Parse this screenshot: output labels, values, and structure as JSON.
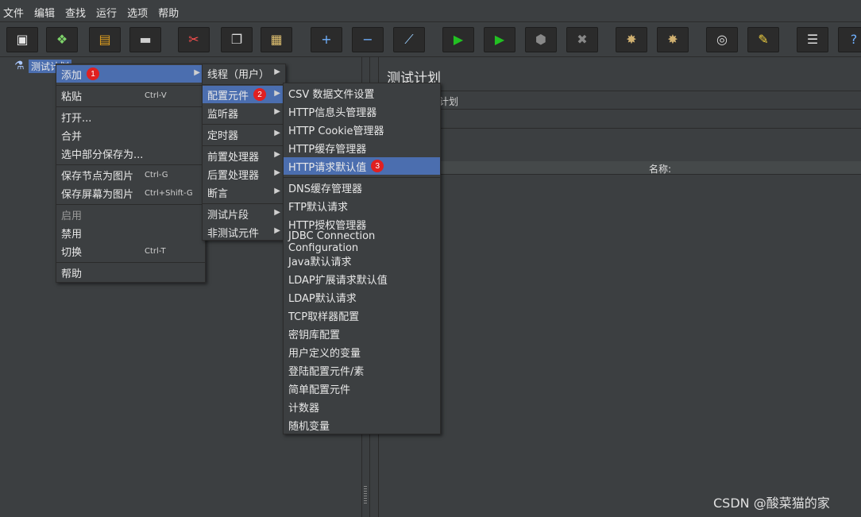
{
  "menubar": [
    "文件",
    "编辑",
    "查找",
    "运行",
    "选项",
    "帮助"
  ],
  "toolbar": [
    {
      "icon": "new-icon",
      "glyph": "▣",
      "color": "#e6e6e6"
    },
    {
      "icon": "templates-icon",
      "glyph": "❖",
      "color": "#7ed36a"
    },
    {
      "icon": "open-icon",
      "glyph": "▤",
      "color": "#e0a020"
    },
    {
      "icon": "save-icon",
      "glyph": "▬",
      "color": "#cfcfcf"
    },
    {
      "icon": "cut-icon",
      "glyph": "✂",
      "color": "#ff5050"
    },
    {
      "icon": "copy-icon",
      "glyph": "❐",
      "color": "#dddddd"
    },
    {
      "icon": "paste-icon",
      "glyph": "▦",
      "color": "#e0c070"
    },
    {
      "icon": "expand-icon",
      "glyph": "+",
      "color": "#6fb0ff"
    },
    {
      "icon": "collapse-icon",
      "glyph": "−",
      "color": "#6fb0ff"
    },
    {
      "icon": "toggle-icon",
      "glyph": "⟋",
      "color": "#9bd0ff"
    },
    {
      "icon": "start-icon",
      "glyph": "▶",
      "color": "#22c022"
    },
    {
      "icon": "start-no-pauses-icon",
      "glyph": "▶",
      "color": "#22c022"
    },
    {
      "icon": "stop-icon",
      "glyph": "⬢",
      "color": "#888888"
    },
    {
      "icon": "shutdown-icon",
      "glyph": "✖",
      "color": "#888888"
    },
    {
      "icon": "clear-icon",
      "glyph": "✸",
      "color": "#d0b070"
    },
    {
      "icon": "clear-all-icon",
      "glyph": "✸",
      "color": "#d0b070"
    },
    {
      "icon": "search-icon",
      "glyph": "◎",
      "color": "#dddddd"
    },
    {
      "icon": "reset-search-icon",
      "glyph": "✎",
      "color": "#f0d040"
    },
    {
      "icon": "function-helper-icon",
      "glyph": "☰",
      "color": "#dddddd"
    },
    {
      "icon": "help-icon",
      "glyph": "?",
      "color": "#6fb0ff"
    }
  ],
  "tree": {
    "label": "测试计划",
    "icon": "test-plan-icon"
  },
  "right": {
    "title": "测试计划",
    "name_value": "计划",
    "name_header": "名称:"
  },
  "menu1": {
    "items": [
      {
        "label": "添加",
        "badge": "1",
        "arrow": true,
        "selected": true
      },
      {
        "label": "粘贴",
        "shortcut": "Ctrl-V"
      },
      {
        "label": "打开..."
      },
      {
        "label": "合并"
      },
      {
        "label": "选中部分保存为..."
      },
      {
        "label": "保存节点为图片",
        "shortcut": "Ctrl-G"
      },
      {
        "label": "保存屏幕为图片",
        "shortcut": "Ctrl+Shift-G"
      },
      {
        "label": "启用",
        "dim": true
      },
      {
        "label": "禁用"
      },
      {
        "label": "切换",
        "shortcut": "Ctrl-T"
      },
      {
        "label": "帮助"
      }
    ]
  },
  "menu2": {
    "items": [
      {
        "label": "线程（用户）",
        "arrow": true
      },
      {
        "label": "配置元件",
        "badge": "2",
        "arrow": true,
        "selected": true
      },
      {
        "label": "监听器",
        "arrow": true
      },
      {
        "label": "定时器",
        "arrow": true
      },
      {
        "label": "前置处理器",
        "arrow": true
      },
      {
        "label": "后置处理器",
        "arrow": true
      },
      {
        "label": "断言",
        "arrow": true
      },
      {
        "label": "测试片段",
        "arrow": true
      },
      {
        "label": "非测试元件",
        "arrow": true
      }
    ]
  },
  "menu3": {
    "items": [
      {
        "label": "CSV 数据文件设置"
      },
      {
        "label": "HTTP信息头管理器"
      },
      {
        "label": "HTTP Cookie管理器"
      },
      {
        "label": "HTTP缓存管理器"
      },
      {
        "label": "HTTP请求默认值",
        "badge": "3",
        "selected": true
      },
      {
        "label": "DNS缓存管理器"
      },
      {
        "label": "FTP默认请求"
      },
      {
        "label": "HTTP授权管理器"
      },
      {
        "label": "JDBC Connection Configuration"
      },
      {
        "label": "Java默认请求"
      },
      {
        "label": "LDAP扩展请求默认值"
      },
      {
        "label": "LDAP默认请求"
      },
      {
        "label": "TCP取样器配置"
      },
      {
        "label": "密钥库配置"
      },
      {
        "label": "用户定义的变量"
      },
      {
        "label": "登陆配置元件/素"
      },
      {
        "label": "简单配置元件"
      },
      {
        "label": "计数器"
      },
      {
        "label": "随机变量"
      }
    ]
  },
  "watermark": "CSDN @酸菜猫的家"
}
